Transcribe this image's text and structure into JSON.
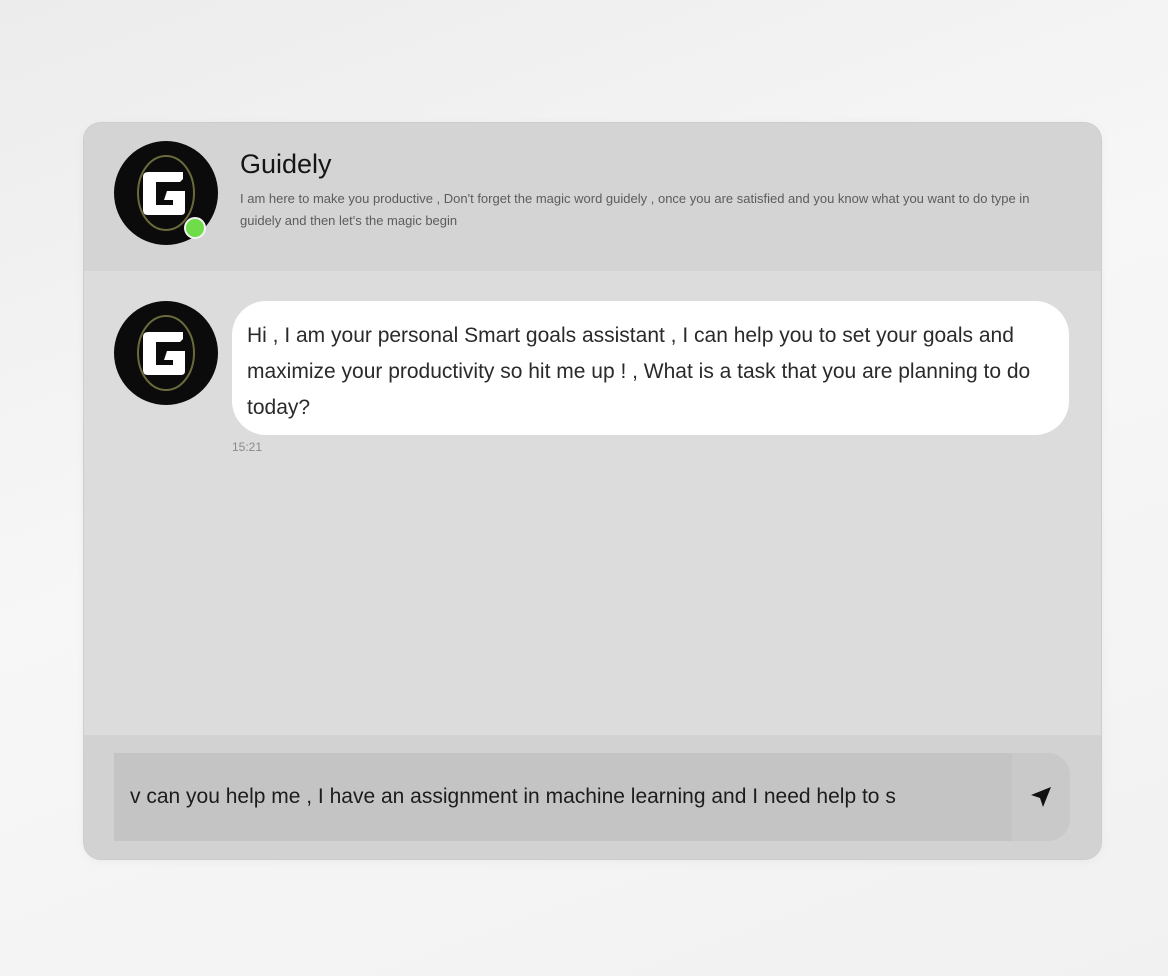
{
  "header": {
    "bot_name": "Guidely",
    "description": "I am here to make you productive , Don't forget the magic word guidely , once you are satisfied and you know what you want to do type in guidely and then let's the magic begin",
    "avatar_icon": "guidely-logo-icon",
    "status_color": "#6fdc4a"
  },
  "messages": [
    {
      "sender": "bot",
      "text": "Hi , I am your personal Smart goals assistant , I can help you to set your goals and maximize your productivity so hit me up ! , What is a task that you are planning to do today?",
      "time": "15:21"
    }
  ],
  "composer": {
    "value": "v can you help me , I have an assignment in machine learning and I need help to s",
    "send_icon": "send-arrow-icon"
  }
}
